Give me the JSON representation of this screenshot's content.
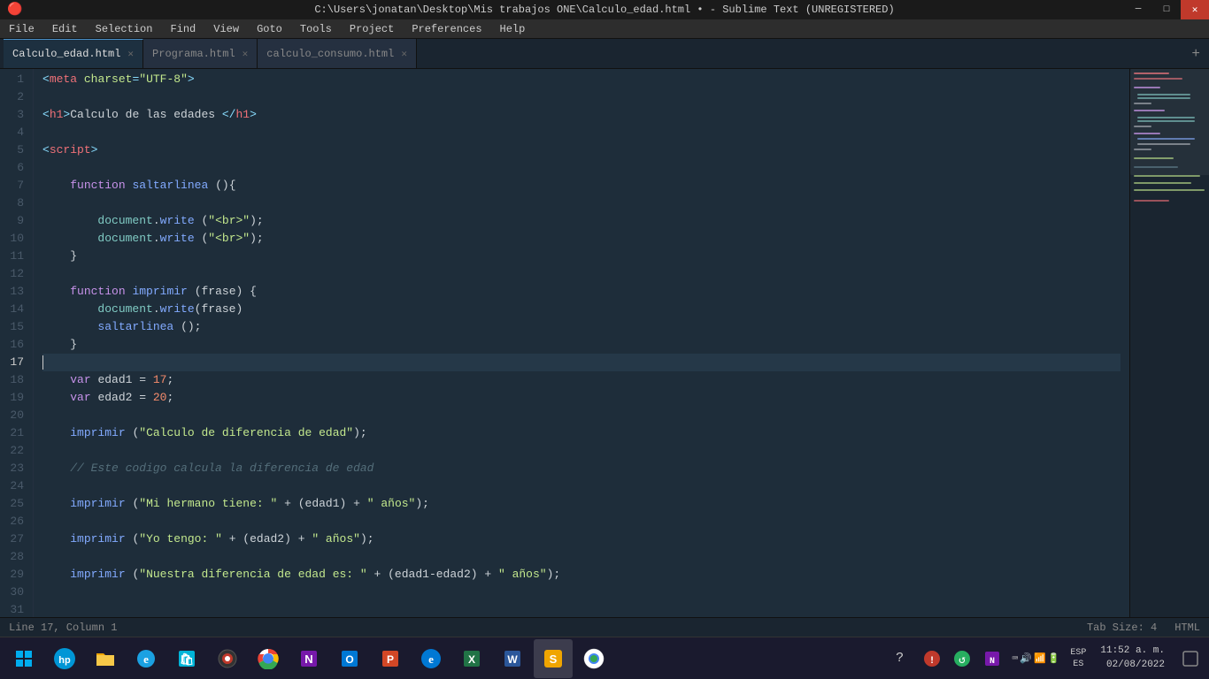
{
  "titleBar": {
    "title": "C:\\Users\\jonatan\\Desktop\\Mis trabajos ONE\\Calculo_edad.html • - Sublime Text (UNREGISTERED)",
    "icon": "●"
  },
  "menuBar": {
    "items": [
      "File",
      "Edit",
      "Selection",
      "Find",
      "View",
      "Goto",
      "Tools",
      "Project",
      "Preferences",
      "Help"
    ]
  },
  "tabs": [
    {
      "label": "Calculo_edad.html",
      "active": true
    },
    {
      "label": "Programa.html",
      "active": false
    },
    {
      "label": "calculo_consumo.html",
      "active": false
    }
  ],
  "statusBar": {
    "position": "Line 17, Column 1",
    "tabSize": "Tab Size: 4",
    "syntax": "HTML"
  },
  "taskbar": {
    "startLabel": "⊞",
    "clock": "11:52 a. m.",
    "date": "02/08/2022",
    "lang": "ESP\nES"
  }
}
